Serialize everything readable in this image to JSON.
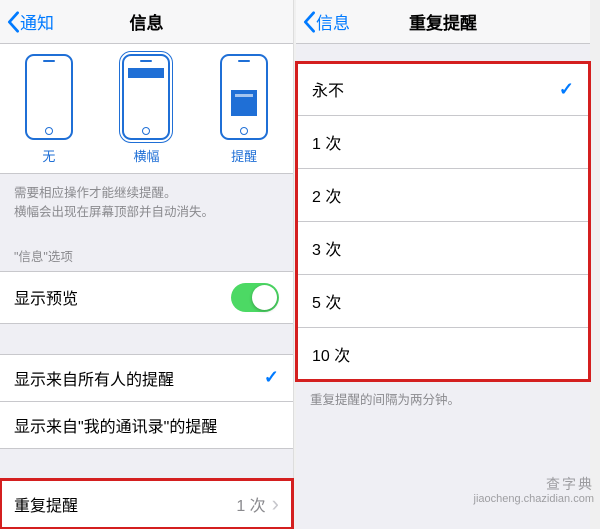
{
  "left": {
    "nav": {
      "back": "通知",
      "title": "信息"
    },
    "alertStyles": {
      "none": "无",
      "banner": "横幅",
      "alert": "提醒"
    },
    "note": {
      "line1": "需要相应操作才能继续提醒。",
      "line2": "横幅会出现在屏幕顶部并自动消失。"
    },
    "optionsHeader": "\"信息\"选项",
    "previewLabel": "显示预览",
    "alertsFrom": {
      "everyone": "显示来自所有人的提醒",
      "contacts": "显示来自\"我的通讯录\"的提醒"
    },
    "repeat": {
      "label": "重复提醒",
      "value": "1 次"
    }
  },
  "right": {
    "nav": {
      "back": "信息",
      "title": "重复提醒"
    },
    "options": [
      {
        "label": "永不",
        "selected": true
      },
      {
        "label": "1 次",
        "selected": false
      },
      {
        "label": "2 次",
        "selected": false
      },
      {
        "label": "3 次",
        "selected": false
      },
      {
        "label": "5 次",
        "selected": false
      },
      {
        "label": "10 次",
        "selected": false
      }
    ],
    "footer": "重复提醒的间隔为两分钟。"
  },
  "watermark": {
    "ch": "查字典",
    "en": "jiaocheng.chazidian.com"
  }
}
